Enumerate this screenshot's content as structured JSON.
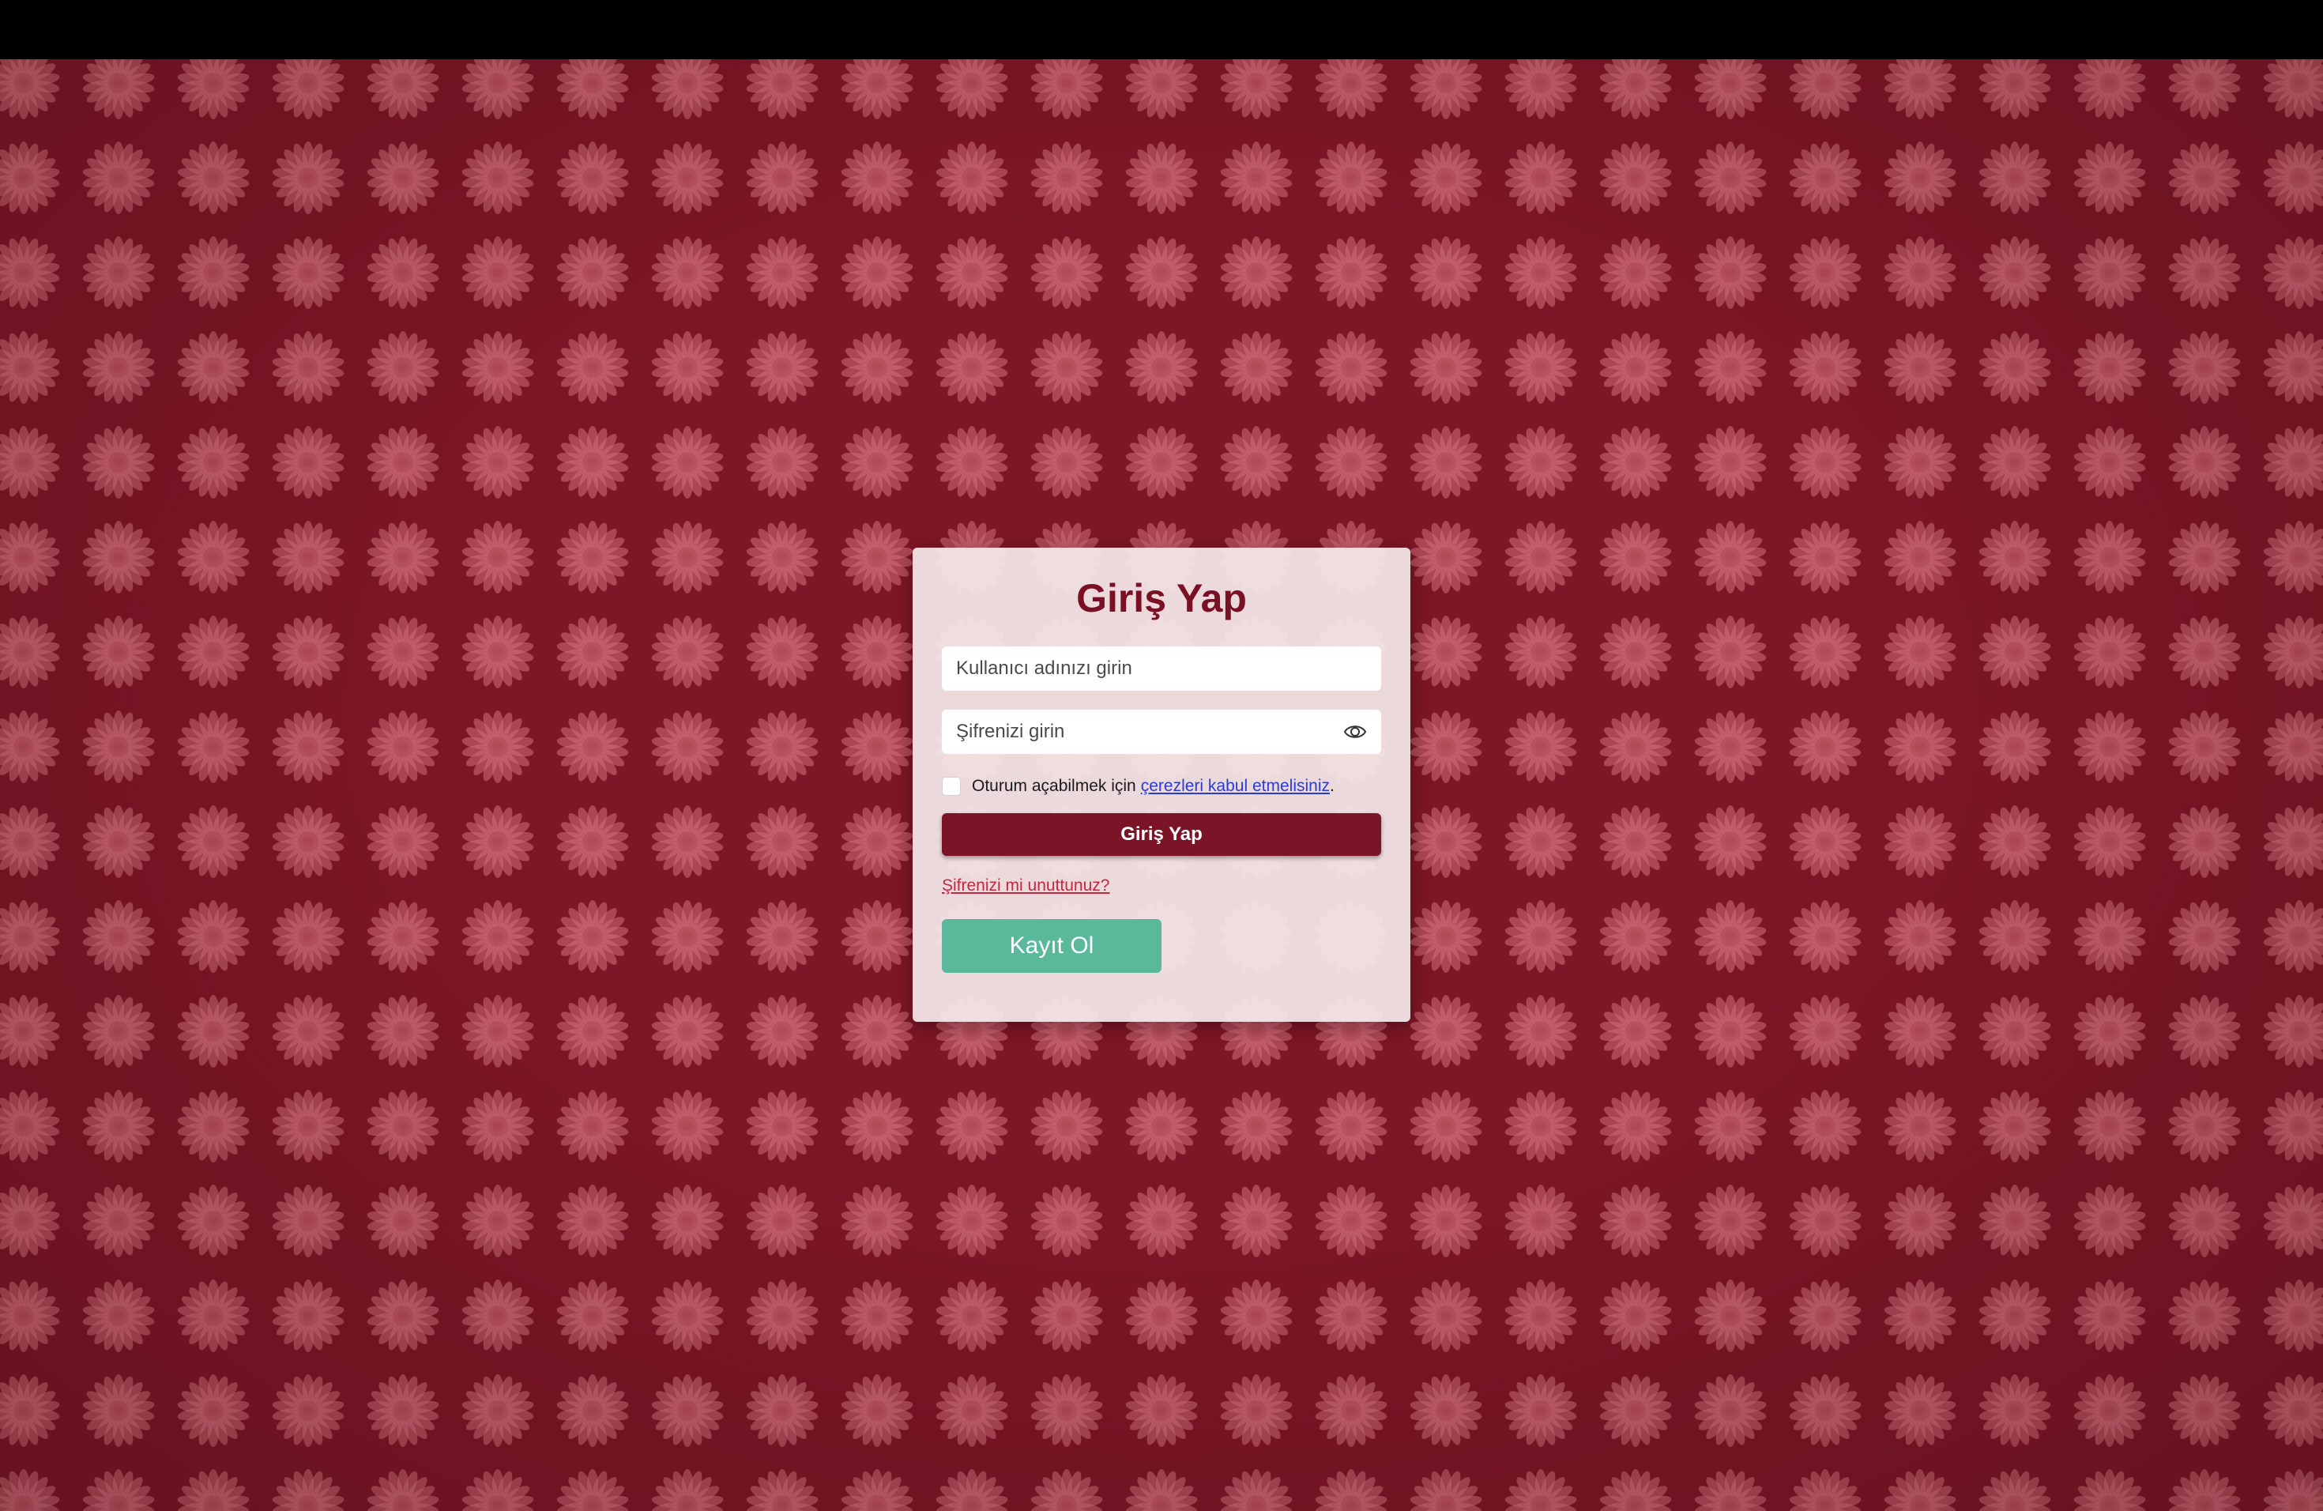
{
  "login_card": {
    "title": "Giriş Yap",
    "username_placeholder": "Kullanıcı adınızı girin",
    "password_placeholder": "Şifrenizi girin",
    "consent_text": "Oturum açabilmek için",
    "consent_link": "çerezleri kabul etmelisiniz",
    "consent_suffix": ".",
    "login_button": "Giriş Yap",
    "forgot_link": "Şifrenizi mi unuttunuz?",
    "register_button": "Kayıt Ol"
  },
  "colors": {
    "background": "#7d1626",
    "flower_pattern": "#d36d7a",
    "title": "#7a1024",
    "login_button": "#7a1426",
    "register_button": "#5ab89b",
    "consent_link": "#2a3bd6",
    "forgot_link": "#c4283f"
  },
  "icons": {
    "password_toggle": "eye-icon",
    "background": "daisy-flower-pattern"
  }
}
